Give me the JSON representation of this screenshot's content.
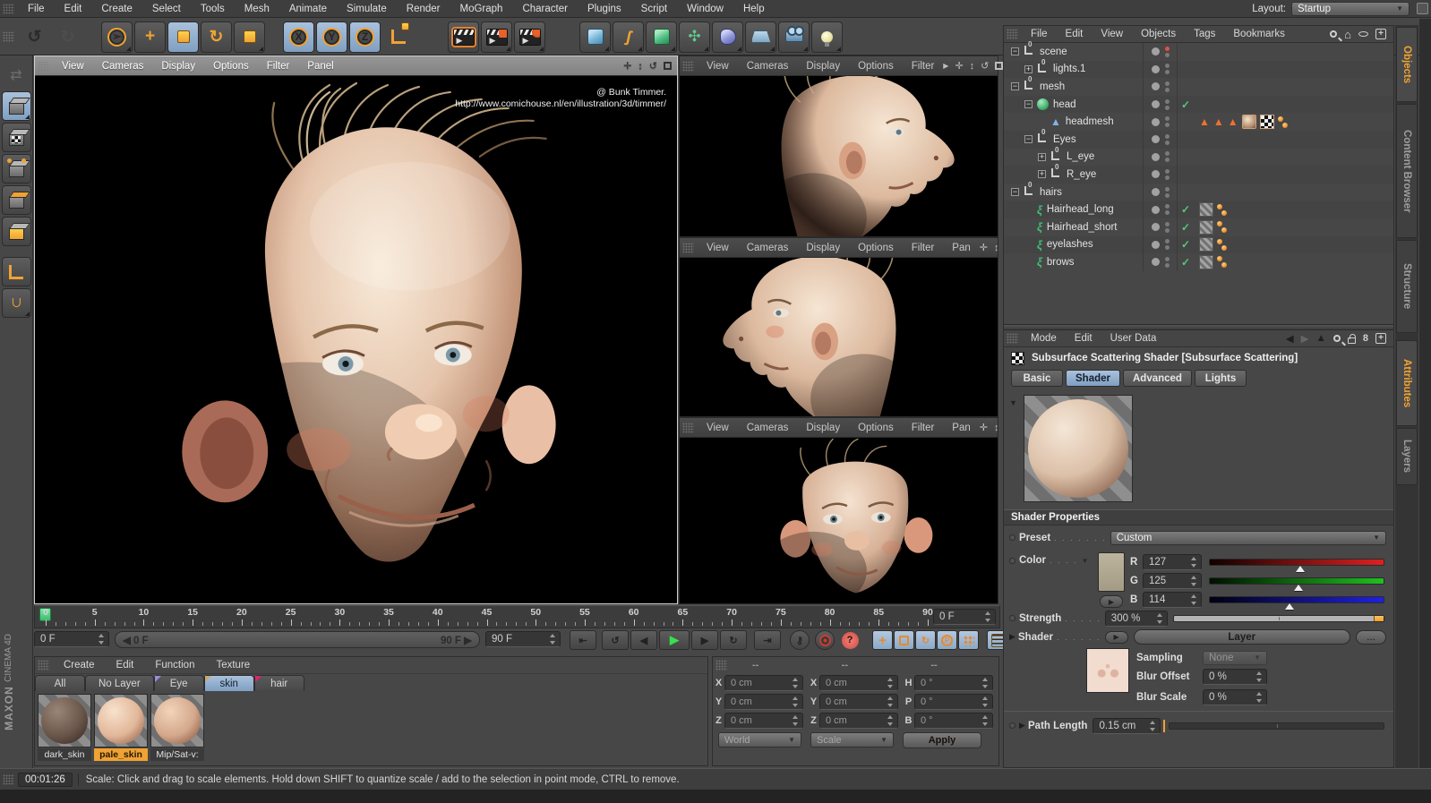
{
  "menubar": [
    "File",
    "Edit",
    "Create",
    "Select",
    "Tools",
    "Mesh",
    "Animate",
    "Simulate",
    "Render",
    "MoGraph",
    "Character",
    "Plugins",
    "Script",
    "Window",
    "Help"
  ],
  "window": {
    "layout_label": "Layout:",
    "layout_value": "Startup"
  },
  "viewports": {
    "main": {
      "menu": [
        "View",
        "Cameras",
        "Display",
        "Options",
        "Filter",
        "Panel"
      ],
      "credit1": "@ Bunk Timmer.",
      "credit2": "http://www.comichouse.nl/en/illustration/3d/timmer/"
    },
    "top": {
      "menu": [
        "View",
        "Cameras",
        "Display",
        "Options",
        "Filter"
      ],
      "overflow": "▶"
    },
    "middle": {
      "menu": [
        "View",
        "Cameras",
        "Display",
        "Options",
        "Filter",
        "Pan"
      ]
    },
    "bottom": {
      "menu": [
        "View",
        "Cameras",
        "Display",
        "Options",
        "Filter",
        "Pan"
      ]
    }
  },
  "object_manager": {
    "menu": [
      "File",
      "Edit",
      "View",
      "Objects",
      "Tags",
      "Bookmarks"
    ],
    "rows": [
      {
        "label": "scene"
      },
      {
        "label": "lights.1"
      },
      {
        "label": "mesh"
      },
      {
        "label": "head"
      },
      {
        "label": "headmesh"
      },
      {
        "label": "Eyes"
      },
      {
        "label": "L_eye"
      },
      {
        "label": "R_eye"
      },
      {
        "label": "hairs"
      },
      {
        "label": "Hairhead_long"
      },
      {
        "label": "Hairhead_short"
      },
      {
        "label": "eyelashes"
      },
      {
        "label": "brows"
      }
    ],
    "side_tabs": [
      "Objects",
      "Content Browser",
      "Structure"
    ],
    "active_side_tab": "Objects"
  },
  "attributes": {
    "menu": [
      "Mode",
      "Edit",
      "User Data"
    ],
    "title": "Subsurface Scattering Shader [Subsurface Scattering]",
    "tabs": [
      "Basic",
      "Shader",
      "Advanced",
      "Lights"
    ],
    "active_tab": "Shader",
    "section": "Shader Properties",
    "preset": {
      "label": "Preset",
      "value": "Custom"
    },
    "color": {
      "label": "Color",
      "r_label": "R",
      "r": "127",
      "g_label": "G",
      "g": "125",
      "b_label": "B",
      "b": "114",
      "swatch": "#b3ab96"
    },
    "strength": {
      "label": "Strength",
      "value": "300 %"
    },
    "shader": {
      "label": "Shader",
      "button": "Layer",
      "more": "..."
    },
    "sampling": {
      "label": "Sampling",
      "value": "None"
    },
    "blur_offset": {
      "label": "Blur Offset",
      "value": "0 %"
    },
    "blur_scale": {
      "label": "Blur Scale",
      "value": "0 %"
    },
    "path_length": {
      "label": "Path Length",
      "value": "0.15 cm"
    },
    "side_tabs": [
      "Attributes",
      "Layers"
    ],
    "active_side_tab": "Attributes"
  },
  "timeline": {
    "start": 0,
    "end": 90,
    "step": 5,
    "current_field": "0 F",
    "loop_start": "0 F",
    "loop_end": "90 F",
    "range_min": "0 F",
    "range_max": "90 F"
  },
  "material_manager": {
    "menu": [
      "Create",
      "Edit",
      "Function",
      "Texture"
    ],
    "tabs": [
      "All",
      "No Layer",
      "Eye",
      "skin",
      "hair"
    ],
    "active_tab": "skin",
    "items": [
      {
        "name": "dark_skin"
      },
      {
        "name": "pale_skin",
        "selected": true
      },
      {
        "name": "Mip/Sat-v:"
      }
    ]
  },
  "coordinates": {
    "headers": [
      "--",
      "--",
      "--"
    ],
    "labels": {
      "x": "X",
      "y": "Y",
      "z": "Z",
      "h": "H",
      "p": "P",
      "b": "B"
    },
    "position": {
      "x": "0 cm",
      "y": "0 cm",
      "z": "0 cm"
    },
    "scale": {
      "x": "0 cm",
      "y": "0 cm",
      "z": "0 cm"
    },
    "rotation": {
      "h": "0 °",
      "p": "0 °",
      "b": "0 °"
    },
    "mode1": "World",
    "mode2": "Scale",
    "apply": "Apply"
  },
  "status": {
    "time": "00:01:26",
    "message": "Scale: Click and drag to scale elements. Hold down SHIFT to quantize scale / add to the selection in point mode, CTRL to remove."
  },
  "brand": {
    "line1": "MAXON",
    "line2": "CINEMA 4D"
  },
  "colors": {
    "accent_orange": "#f0a232",
    "active_blue": "#8fb0d2",
    "check_green": "#58c878",
    "record_red": "#d04c42",
    "play_green": "#35e24c",
    "playhead_green": "#3cba6c"
  }
}
